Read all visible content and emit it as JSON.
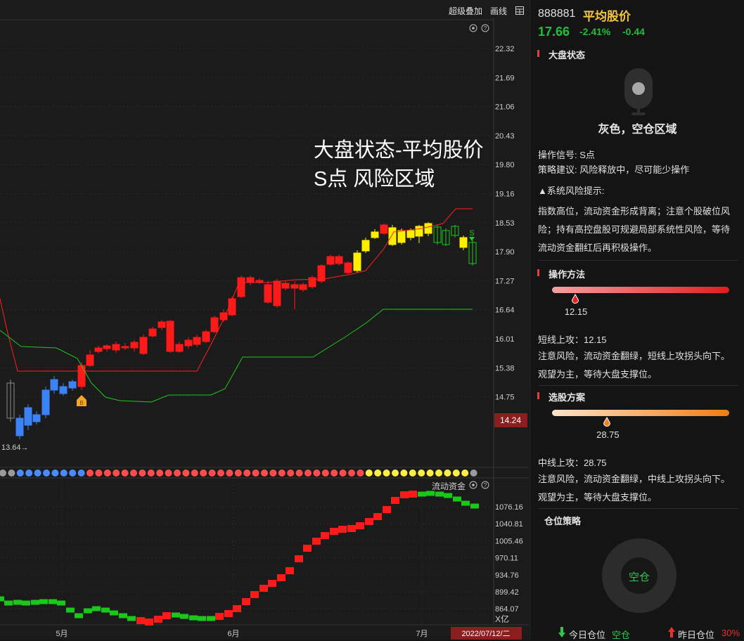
{
  "toolbar": {
    "overlay_btn": "超级叠加",
    "draw_btn": "画线"
  },
  "overlay": {
    "line1": "大盘状态-平均股价",
    "line2": "S点 风险区域"
  },
  "main_chart": {
    "price_labels": [
      "22.32",
      "21.69",
      "21.06",
      "20.43",
      "19.80",
      "19.16",
      "18.53",
      "17.90",
      "17.27",
      "16.64",
      "16.01",
      "15.38",
      "14.75"
    ],
    "current_price": "14.24",
    "low_label": "13.64",
    "b_marker": "B",
    "s_marker": "S"
  },
  "sub_chart": {
    "title": "流动资金",
    "labels": [
      "1076.16",
      "1040.81",
      "1005.46",
      "970.11",
      "934.76",
      "899.42",
      "864.07"
    ],
    "unit": "X亿"
  },
  "x_axis": {
    "ticks": [
      "5月",
      "6月",
      "7月"
    ],
    "cursor_date": "2022/07/12/二"
  },
  "colors": {
    "up": "#ff1a1a",
    "down": "#18c918",
    "yellow": "#ffee00",
    "blue": "#3b82f6",
    "label_red": "#8b1e1e"
  },
  "panel": {
    "code": "888881",
    "name": "平均股价",
    "price": "17.66",
    "change_pct": "-2.41%",
    "change": "-0.44",
    "market_state_title": "大盘状态",
    "state_text": "灰色，空仓区域",
    "signal": "操作信号: S点",
    "advice": "策略建议: 风险释放中，尽可能少操作",
    "risk_title": "▲系统风险提示:",
    "risk_text": "指数高位，流动资金形成背离；注意个股破位风险；持有高控盘股可规避局部系统性风险，等待流动资金翻红后再积极操作。",
    "method_title": "操作方法",
    "method_value": "12.15",
    "method_fraction": 0.13,
    "short_attack": "短线上攻：12.15",
    "short_text": "注意风险，流动资金翻绿，短线上攻拐头向下。观望为主，等待大盘支撑位。",
    "pick_title": "选股方案",
    "pick_value": "28.75",
    "pick_fraction": 0.31,
    "mid_attack": "中线上攻：28.75",
    "mid_text": "注意风险，流动资金翻绿，中线上攻拐头向下。观望为主，等待大盘支撑位。",
    "position_title": "仓位策略",
    "position_state": "空仓",
    "today_label": "今日仓位",
    "today_value": "空仓",
    "yesterday_label": "昨日仓位",
    "yesterday_value": "30%"
  }
}
